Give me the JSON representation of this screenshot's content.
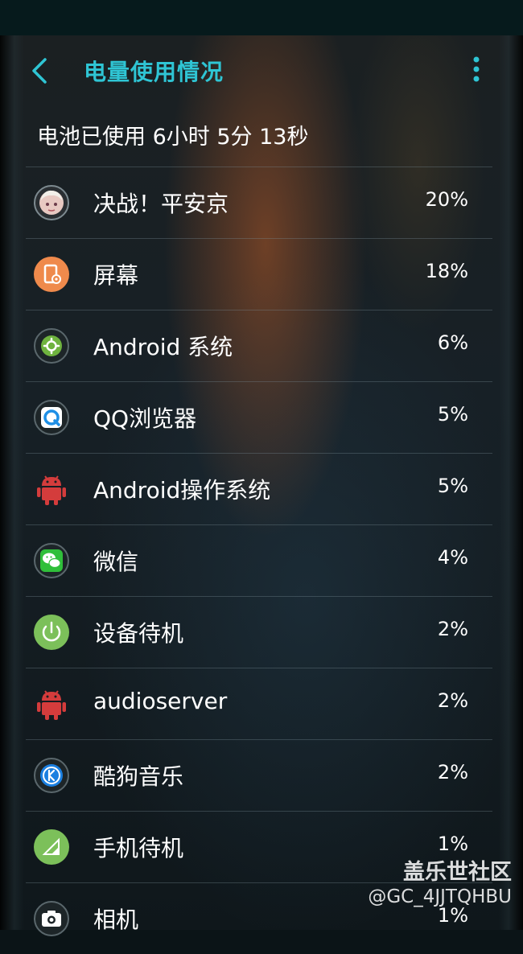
{
  "header": {
    "title": "电量使用情况",
    "back_icon": "chevron-left-icon",
    "more_icon": "more-vertical-icon"
  },
  "summary": "电池已使用 6小时 5分 13秒",
  "colors": {
    "accent": "#2fc5d4",
    "status_bar": "#061a1c"
  },
  "usage_items": [
    {
      "label": "决战！平安京",
      "percent": "20%",
      "icon": "game-avatar-icon"
    },
    {
      "label": "屏幕",
      "percent": "18%",
      "icon": "screen-icon"
    },
    {
      "label": "Android 系统",
      "percent": "6%",
      "icon": "android-system-gear-icon"
    },
    {
      "label": "QQ浏览器",
      "percent": "5%",
      "icon": "qq-browser-icon"
    },
    {
      "label": "Android操作系统",
      "percent": "5%",
      "icon": "android-robot-icon"
    },
    {
      "label": "微信",
      "percent": "4%",
      "icon": "wechat-icon"
    },
    {
      "label": "设备待机",
      "percent": "2%",
      "icon": "power-standby-icon"
    },
    {
      "label": "audioserver",
      "percent": "2%",
      "icon": "android-robot-icon"
    },
    {
      "label": "酷狗音乐",
      "percent": "2%",
      "icon": "kugou-music-icon"
    },
    {
      "label": "手机待机",
      "percent": "1%",
      "icon": "signal-icon"
    },
    {
      "label": "相机",
      "percent": "1%",
      "icon": "camera-icon"
    }
  ],
  "watermark": {
    "line1": "盖乐世社区",
    "line2": "@GC_4JJTQHBU"
  }
}
